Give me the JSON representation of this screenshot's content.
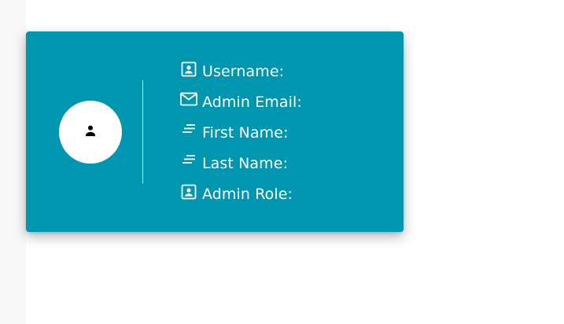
{
  "colors": {
    "card_background": "#0096b0",
    "text": "#ffffff",
    "avatar_background": "#ffffff",
    "avatar_icon": "#000000"
  },
  "profile_card": {
    "avatar_icon": "person-icon",
    "fields": [
      {
        "icon": "account-box-icon",
        "label": "Username:"
      },
      {
        "icon": "mail-icon",
        "label": "Admin Email:"
      },
      {
        "icon": "short-text-icon",
        "label": "First Name:"
      },
      {
        "icon": "short-text-icon",
        "label": "Last Name:"
      },
      {
        "icon": "account-box-icon",
        "label": "Admin Role:"
      }
    ]
  }
}
